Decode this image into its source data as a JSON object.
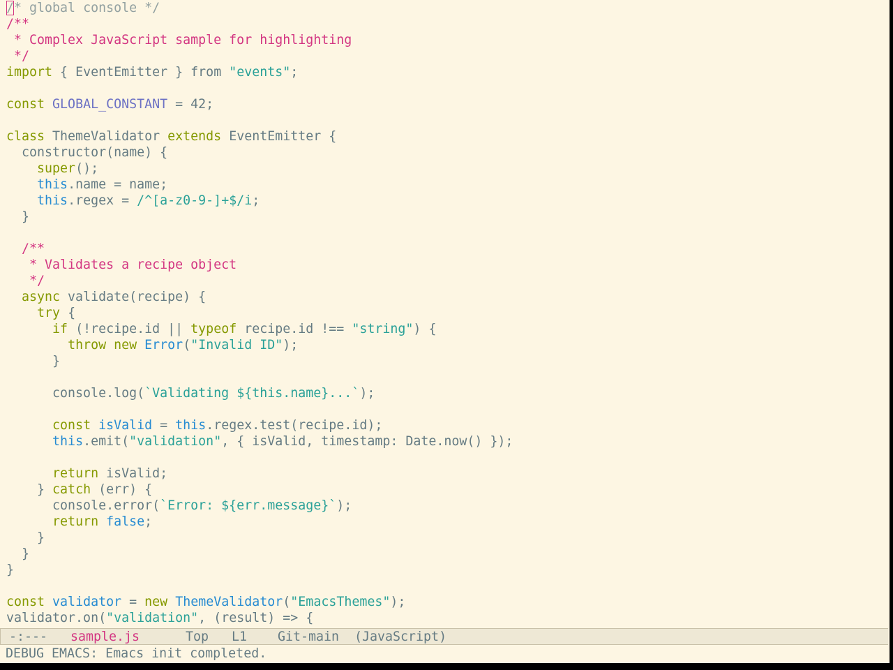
{
  "colors": {
    "background": "#fdf6e3",
    "default": "#657b83",
    "comment": "#93a1a1",
    "doc": "#d33682",
    "keyword": "#859900",
    "string": "#2aa198",
    "builtin": "#268bd2",
    "variable": "#6c71c4",
    "modeline_bg": "#eee8d5"
  },
  "editor": {
    "lines": [
      [
        {
          "t": "/",
          "c": "comment",
          "cursor": true
        },
        {
          "t": "* global console */",
          "c": "comment"
        }
      ],
      [
        {
          "t": "/**",
          "c": "doc"
        }
      ],
      [
        {
          "t": " * Complex JavaScript sample for highlighting",
          "c": "doc"
        }
      ],
      [
        {
          "t": " */",
          "c": "doc"
        }
      ],
      [
        {
          "t": "import",
          "c": "keyword"
        },
        {
          "t": " { EventEmitter } ",
          "c": "default"
        },
        {
          "t": "from",
          "c": "default"
        },
        {
          "t": " ",
          "c": "default"
        },
        {
          "t": "\"events\"",
          "c": "string"
        },
        {
          "t": ";",
          "c": "default"
        }
      ],
      [],
      [
        {
          "t": "const",
          "c": "keyword"
        },
        {
          "t": " ",
          "c": "default"
        },
        {
          "t": "GLOBAL_CONSTANT",
          "c": "variable"
        },
        {
          "t": " = 42;",
          "c": "default"
        }
      ],
      [],
      [
        {
          "t": "class",
          "c": "keyword"
        },
        {
          "t": " ThemeValidator ",
          "c": "default"
        },
        {
          "t": "extends",
          "c": "keyword"
        },
        {
          "t": " EventEmitter {",
          "c": "default"
        }
      ],
      [
        {
          "t": "  constructor(name) {",
          "c": "default"
        }
      ],
      [
        {
          "t": "    ",
          "c": "default"
        },
        {
          "t": "super",
          "c": "keyword"
        },
        {
          "t": "();",
          "c": "default"
        }
      ],
      [
        {
          "t": "    ",
          "c": "default"
        },
        {
          "t": "this",
          "c": "builtin"
        },
        {
          "t": ".name = name;",
          "c": "default"
        }
      ],
      [
        {
          "t": "    ",
          "c": "default"
        },
        {
          "t": "this",
          "c": "builtin"
        },
        {
          "t": ".regex = ",
          "c": "default"
        },
        {
          "t": "/^[a-z0-9-]+$/i",
          "c": "string"
        },
        {
          "t": ";",
          "c": "default"
        }
      ],
      [
        {
          "t": "  }",
          "c": "default"
        }
      ],
      [],
      [
        {
          "t": "  /**",
          "c": "doc"
        }
      ],
      [
        {
          "t": "   * Validates a recipe object",
          "c": "doc"
        }
      ],
      [
        {
          "t": "   */",
          "c": "doc"
        }
      ],
      [
        {
          "t": "  ",
          "c": "default"
        },
        {
          "t": "async",
          "c": "keyword"
        },
        {
          "t": " validate(recipe) {",
          "c": "default"
        }
      ],
      [
        {
          "t": "    ",
          "c": "default"
        },
        {
          "t": "try",
          "c": "keyword"
        },
        {
          "t": " {",
          "c": "default"
        }
      ],
      [
        {
          "t": "      ",
          "c": "default"
        },
        {
          "t": "if",
          "c": "keyword"
        },
        {
          "t": " (!recipe.id || ",
          "c": "default"
        },
        {
          "t": "typeof",
          "c": "keyword"
        },
        {
          "t": " recipe.id !== ",
          "c": "default"
        },
        {
          "t": "\"string\"",
          "c": "string"
        },
        {
          "t": ") {",
          "c": "default"
        }
      ],
      [
        {
          "t": "        ",
          "c": "default"
        },
        {
          "t": "throw",
          "c": "keyword"
        },
        {
          "t": " ",
          "c": "default"
        },
        {
          "t": "new",
          "c": "keyword"
        },
        {
          "t": " ",
          "c": "default"
        },
        {
          "t": "Error",
          "c": "builtin"
        },
        {
          "t": "(",
          "c": "default"
        },
        {
          "t": "\"Invalid ID\"",
          "c": "string"
        },
        {
          "t": ");",
          "c": "default"
        }
      ],
      [
        {
          "t": "      }",
          "c": "default"
        }
      ],
      [],
      [
        {
          "t": "      console.log(",
          "c": "default"
        },
        {
          "t": "`Validating ${this.name}...`",
          "c": "string"
        },
        {
          "t": ");",
          "c": "default"
        }
      ],
      [],
      [
        {
          "t": "      ",
          "c": "default"
        },
        {
          "t": "const",
          "c": "keyword"
        },
        {
          "t": " ",
          "c": "default"
        },
        {
          "t": "isValid",
          "c": "builtin"
        },
        {
          "t": " = ",
          "c": "default"
        },
        {
          "t": "this",
          "c": "builtin"
        },
        {
          "t": ".regex.test(recipe.id);",
          "c": "default"
        }
      ],
      [
        {
          "t": "      ",
          "c": "default"
        },
        {
          "t": "this",
          "c": "builtin"
        },
        {
          "t": ".emit(",
          "c": "default"
        },
        {
          "t": "\"validation\"",
          "c": "string"
        },
        {
          "t": ", { isValid, timestamp: Date.now() });",
          "c": "default"
        }
      ],
      [],
      [
        {
          "t": "      ",
          "c": "default"
        },
        {
          "t": "return",
          "c": "keyword"
        },
        {
          "t": " isValid;",
          "c": "default"
        }
      ],
      [
        {
          "t": "    } ",
          "c": "default"
        },
        {
          "t": "catch",
          "c": "keyword"
        },
        {
          "t": " (err) {",
          "c": "default"
        }
      ],
      [
        {
          "t": "      console.error(",
          "c": "default"
        },
        {
          "t": "`Error: ${err.message}`",
          "c": "string"
        },
        {
          "t": ");",
          "c": "default"
        }
      ],
      [
        {
          "t": "      ",
          "c": "default"
        },
        {
          "t": "return",
          "c": "keyword"
        },
        {
          "t": " ",
          "c": "default"
        },
        {
          "t": "false",
          "c": "builtin"
        },
        {
          "t": ";",
          "c": "default"
        }
      ],
      [
        {
          "t": "    }",
          "c": "default"
        }
      ],
      [
        {
          "t": "  }",
          "c": "default"
        }
      ],
      [
        {
          "t": "}",
          "c": "default"
        }
      ],
      [],
      [
        {
          "t": "const",
          "c": "keyword"
        },
        {
          "t": " ",
          "c": "default"
        },
        {
          "t": "validator",
          "c": "builtin"
        },
        {
          "t": " = ",
          "c": "default"
        },
        {
          "t": "new",
          "c": "keyword"
        },
        {
          "t": " ",
          "c": "default"
        },
        {
          "t": "ThemeValidator",
          "c": "builtin"
        },
        {
          "t": "(",
          "c": "default"
        },
        {
          "t": "\"EmacsThemes\"",
          "c": "string"
        },
        {
          "t": ");",
          "c": "default"
        }
      ],
      [
        {
          "t": "validator.on(",
          "c": "default"
        },
        {
          "t": "\"validation\"",
          "c": "string"
        },
        {
          "t": ", (result) => {",
          "c": "default"
        }
      ]
    ]
  },
  "modeline": {
    "status": "-:---",
    "buffer_name": "sample.js",
    "position": "Top",
    "line": "L1",
    "vc": "Git-main",
    "mode": "(JavaScript)"
  },
  "echo_area": {
    "message": "DEBUG EMACS: Emacs init completed."
  }
}
